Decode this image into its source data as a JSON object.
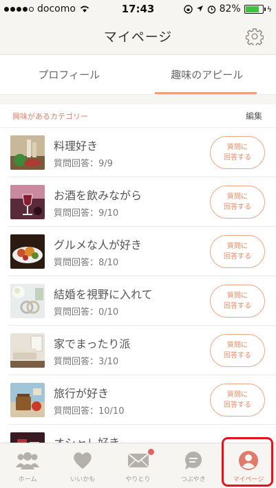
{
  "status": {
    "carrier": "docomo",
    "time": "17:43",
    "battery": "82%",
    "battery_level": 0.82
  },
  "nav": {
    "title": "マイページ",
    "settings_icon": "gear-icon"
  },
  "tabs": [
    {
      "label": "プロフィール",
      "active": false
    },
    {
      "label": "趣味のアピール",
      "active": true
    }
  ],
  "section": {
    "label": "興味があるカテゴリー",
    "edit": "編集"
  },
  "items": [
    {
      "title": "料理好き",
      "answers": "質問回答：9/9",
      "button": "質問に\n回答する",
      "icon": "cooking-photo"
    },
    {
      "title": "お酒を飲みながら",
      "answers": "質問回答：9/10",
      "button": "質問に\n回答する",
      "icon": "wine-photo"
    },
    {
      "title": "グルメな人が好き",
      "answers": "質問回答：8/10",
      "button": "質問に\n回答する",
      "icon": "gourmet-photo"
    },
    {
      "title": "結婚を視野に入れて",
      "answers": "質問回答：0/10",
      "button": "質問に\n回答する",
      "icon": "wedding-photo"
    },
    {
      "title": "家でまったり派",
      "answers": "質問回答：3/10",
      "button": "質問に\n回答する",
      "icon": "home-relax-photo"
    },
    {
      "title": "旅行が好き",
      "answers": "質問回答：10/10",
      "button": "質問に\n回答する",
      "icon": "travel-photo"
    },
    {
      "title": "オシャレ好き",
      "answers": "",
      "button": "",
      "icon": "fashion-photo"
    }
  ],
  "tabbar": [
    {
      "label": "ホーム",
      "icon": "people-icon",
      "active": false
    },
    {
      "label": "いいかも",
      "icon": "heart-icon",
      "active": false
    },
    {
      "label": "やりとり",
      "icon": "mail-icon",
      "active": false,
      "badge": true
    },
    {
      "label": "つぶやき",
      "icon": "chat-bubble-icon",
      "active": false
    },
    {
      "label": "マイページ",
      "icon": "person-icon",
      "active": true
    }
  ],
  "colors": {
    "accent": "#f0a079",
    "active_tab": "#e07a6a",
    "highlight": "#e8101b",
    "badge": "#e8605f"
  }
}
